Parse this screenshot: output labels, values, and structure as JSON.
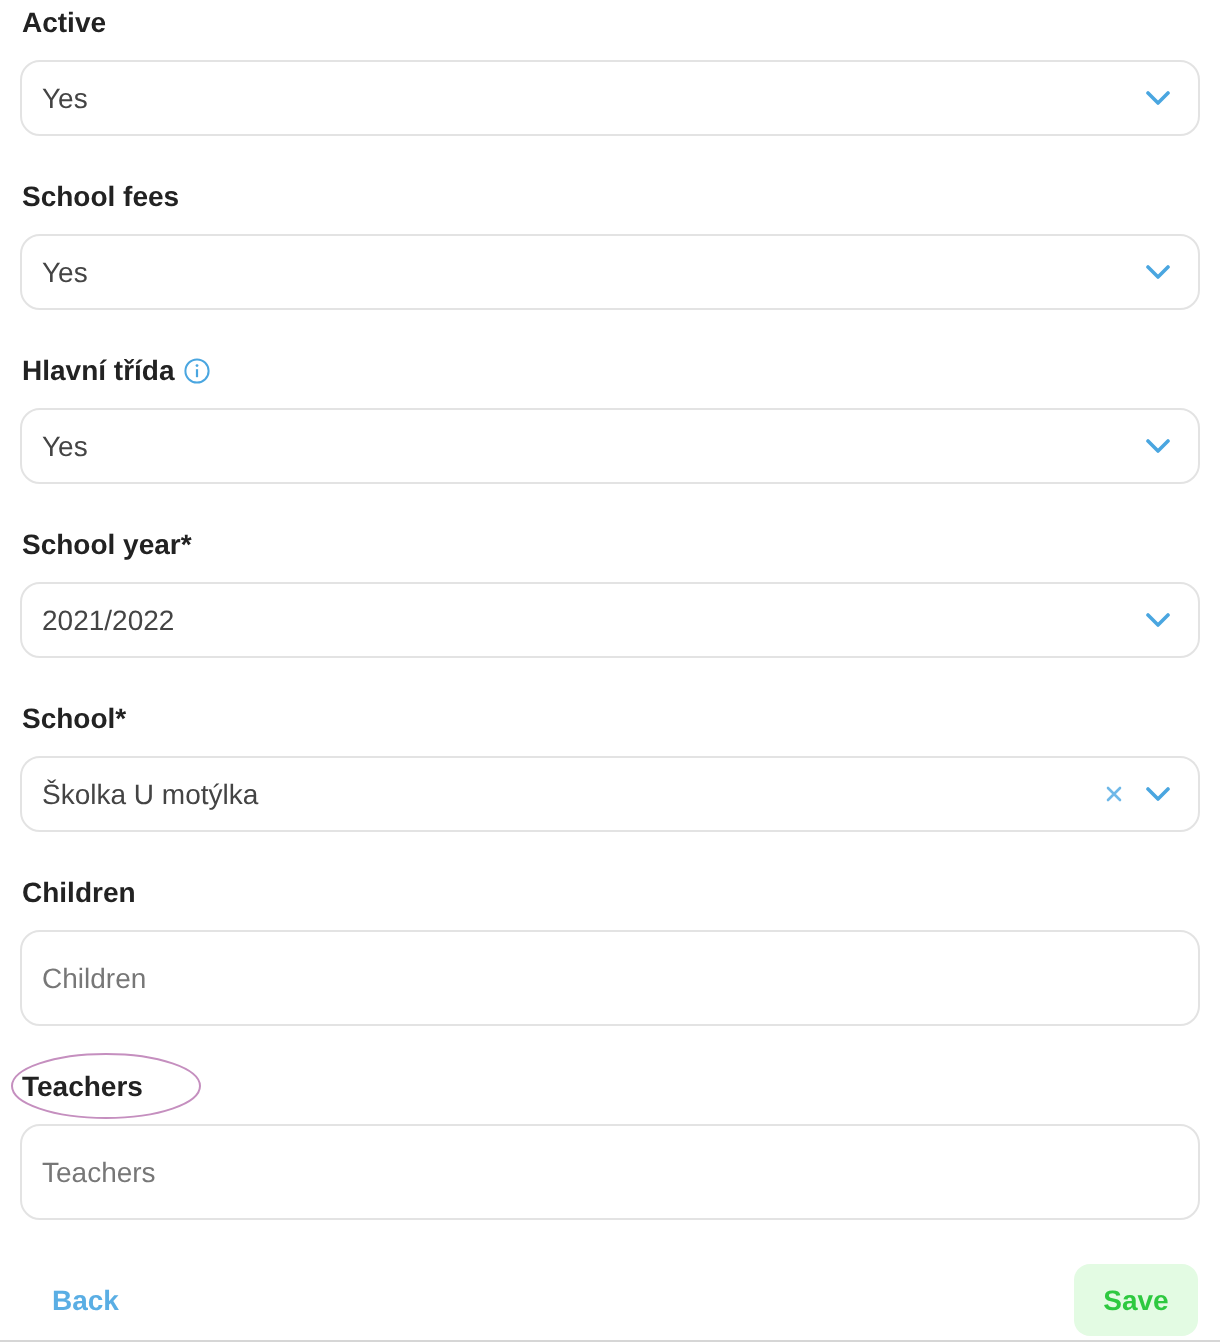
{
  "fields": [
    {
      "kind": "select",
      "label": "Active",
      "value": "Yes",
      "info": false,
      "clearable": false,
      "circled": false
    },
    {
      "kind": "select",
      "label": "School fees",
      "value": "Yes",
      "info": false,
      "clearable": false,
      "circled": false
    },
    {
      "kind": "select",
      "label": "Hlavní třída",
      "value": "Yes",
      "info": true,
      "clearable": false,
      "circled": false
    },
    {
      "kind": "select",
      "label": "School year*",
      "value": "2021/2022",
      "info": false,
      "clearable": false,
      "circled": false
    },
    {
      "kind": "select",
      "label": "School*",
      "value": "Školka U motýlka",
      "info": false,
      "clearable": true,
      "circled": false
    },
    {
      "kind": "input",
      "label": "Children",
      "placeholder": "Children",
      "info": false,
      "clearable": false,
      "circled": false
    },
    {
      "kind": "input",
      "label": "Teachers",
      "placeholder": "Teachers",
      "info": false,
      "clearable": false,
      "circled": true
    }
  ],
  "actions": {
    "back": "Back",
    "save": "Save"
  }
}
